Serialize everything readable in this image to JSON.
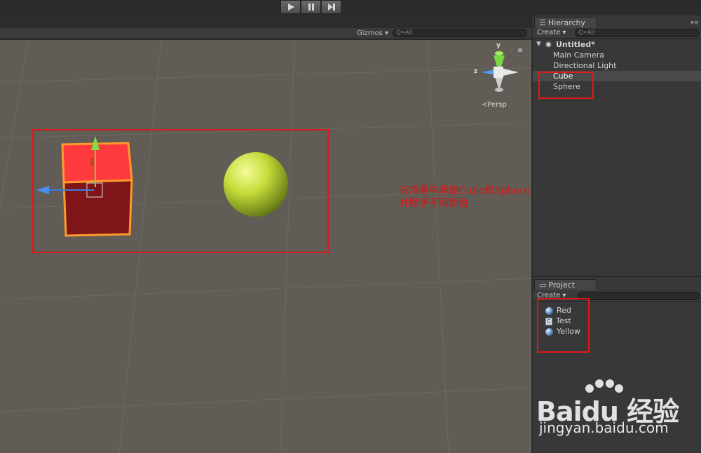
{
  "toolbar": {
    "play_icon": "play-icon",
    "pause_icon": "pause-icon",
    "step_icon": "step-icon"
  },
  "scene": {
    "gizmos_label": "Gizmos ▾",
    "search_placeholder": "Q•All",
    "persp_label": "≺Persp",
    "gizmo_z_label": "z",
    "gizmo_y_label": "y",
    "annotation_line1": "在场景中添加Cube和Sphere",
    "annotation_line2": "并赋予不同颜色"
  },
  "hierarchy": {
    "tab_label": "Hierarchy",
    "create_label": "Create ▾",
    "search_placeholder": "Q•All",
    "scene_name": "Untitled*",
    "items": [
      "Main Camera",
      "Directional Light",
      "Cube",
      "Sphere"
    ]
  },
  "project": {
    "tab_label": "Project",
    "create_label": "Create ▾",
    "items": [
      "Red",
      "Test",
      "Yellow"
    ]
  },
  "watermark": {
    "brand": "Baidu 经验",
    "url": "jingyan.baidu.com"
  },
  "colors": {
    "scene_bg": "#625c56",
    "highlight": "#e01818",
    "cube_red": "#ff3a3a",
    "sphere_yellow": "#c8e03a"
  }
}
